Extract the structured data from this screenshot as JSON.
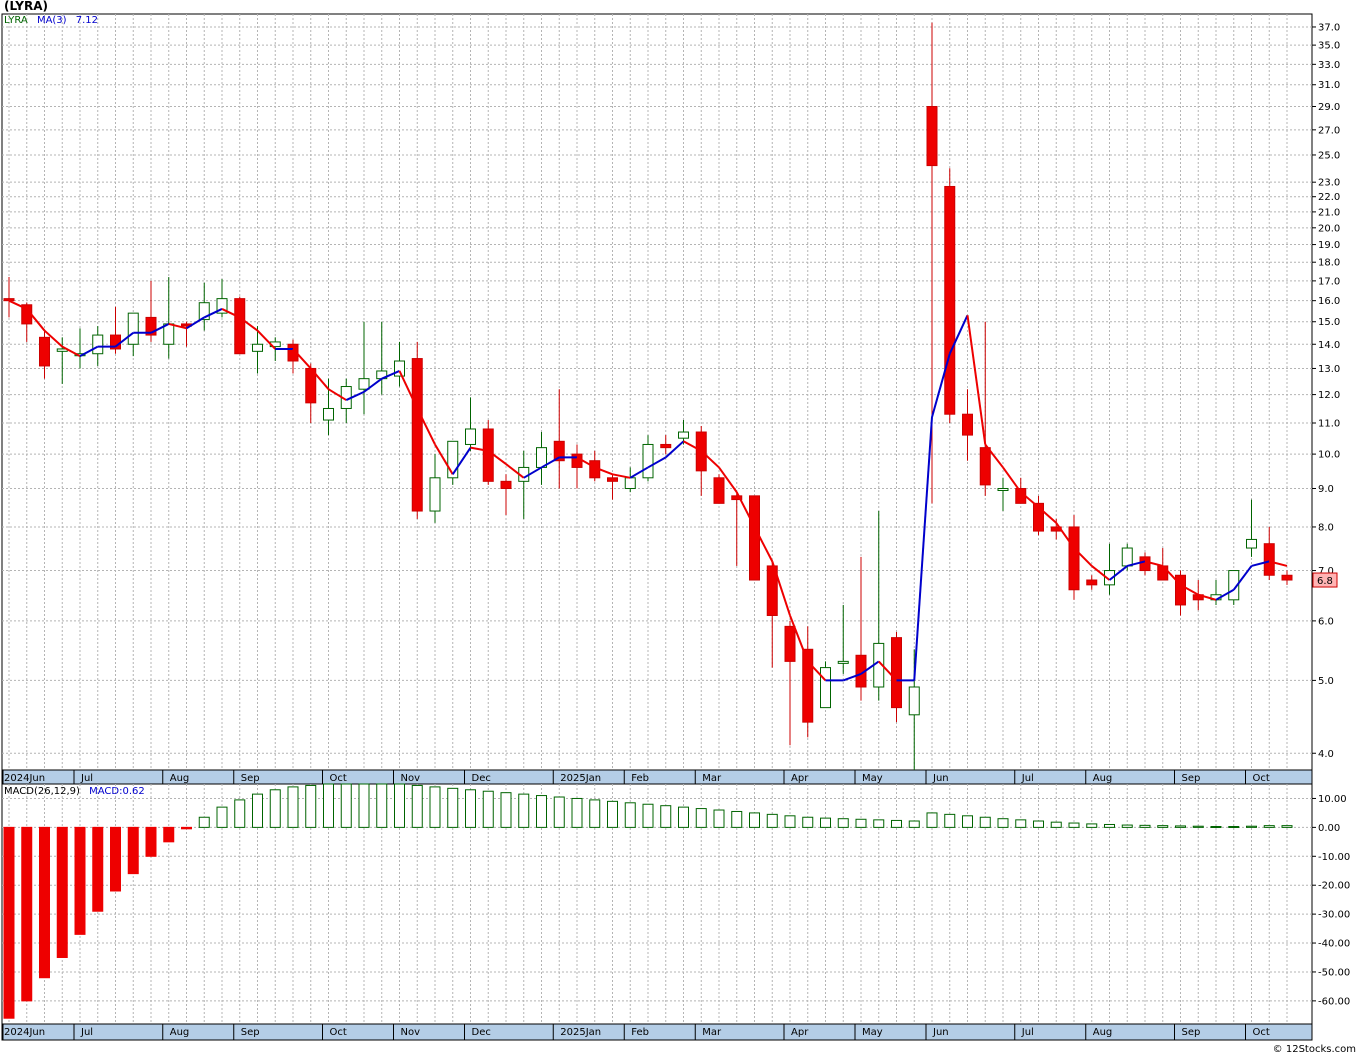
{
  "ticker_label": "(LYRA)",
  "legend": {
    "symbol": "LYRA",
    "ma_label": "MA(3)",
    "ma_value": "7.12",
    "symbol_color": "#006400",
    "ma_color": "#0000cc"
  },
  "macd_legend": {
    "name": "MACD(26,12,9)",
    "value_label": "MACD:0.62"
  },
  "price_tag": "6.8",
  "credit": "© 12Stocks.com",
  "colors": {
    "up_body": "#ffffff",
    "up_border": "#006400",
    "down_body": "#ee0000",
    "down_border": "#cc0000",
    "ma_up": "#0000cc",
    "ma_down": "#ee0000",
    "macd_pos": "#006400",
    "macd_neg": "#ee0000",
    "grid": "#b4b4b4",
    "axis_band": "#b4cde6",
    "price_tag_bg": "#ffb4b4"
  },
  "chart_data": [
    {
      "type": "candlestick",
      "scale": "log",
      "ylim": [
        3.8,
        38.5
      ],
      "grid": true,
      "x_labels": [
        "2024Jun",
        "Jul",
        "Aug",
        "Sep",
        "Oct",
        "Nov",
        "Dec",
        "2025Jan",
        "Feb",
        "Mar",
        "Apr",
        "May",
        "Jun",
        "Jul",
        "Aug",
        "Sep",
        "Oct"
      ],
      "y_ticks": [
        "4.0",
        "5.0",
        "6.0",
        "7.0",
        "8.0",
        "9.0",
        "10.0",
        "11.0",
        "12.0",
        "13.0",
        "14.0",
        "15.0",
        "16.0",
        "17.0",
        "18.0",
        "19.0",
        "20.0",
        "21.0",
        "22.0",
        "23.0",
        "25.0",
        "27.0",
        "29.0",
        "31.0",
        "33.0",
        "35.0",
        "37.0"
      ],
      "bars": [
        {
          "o": 16.1,
          "h": 17.2,
          "l": 15.2,
          "c": 16.0
        },
        {
          "o": 15.8,
          "h": 15.9,
          "l": 14.1,
          "c": 14.9
        },
        {
          "o": 14.3,
          "h": 14.6,
          "l": 12.6,
          "c": 13.1
        },
        {
          "o": 13.7,
          "h": 14.3,
          "l": 12.4,
          "c": 13.8
        },
        {
          "o": 13.6,
          "h": 14.7,
          "l": 13.0,
          "c": 13.6
        },
        {
          "o": 13.6,
          "h": 14.8,
          "l": 13.1,
          "c": 14.4
        },
        {
          "o": 14.4,
          "h": 15.7,
          "l": 13.6,
          "c": 13.8
        },
        {
          "o": 14.0,
          "h": 15.2,
          "l": 13.5,
          "c": 15.4
        },
        {
          "o": 15.2,
          "h": 17.0,
          "l": 14.1,
          "c": 14.4
        },
        {
          "o": 14.0,
          "h": 17.2,
          "l": 13.4,
          "c": 14.9
        },
        {
          "o": 14.9,
          "h": 15.0,
          "l": 13.9,
          "c": 14.8
        },
        {
          "o": 15.1,
          "h": 16.9,
          "l": 14.6,
          "c": 15.9
        },
        {
          "o": 15.4,
          "h": 17.1,
          "l": 15.2,
          "c": 16.1
        },
        {
          "o": 16.1,
          "h": 16.2,
          "l": 13.6,
          "c": 13.6
        },
        {
          "o": 13.7,
          "h": 14.8,
          "l": 12.8,
          "c": 14.0
        },
        {
          "o": 13.9,
          "h": 14.3,
          "l": 13.3,
          "c": 14.1
        },
        {
          "o": 14.0,
          "h": 14.2,
          "l": 12.8,
          "c": 13.3
        },
        {
          "o": 13.0,
          "h": 13.2,
          "l": 11.0,
          "c": 11.7
        },
        {
          "o": 11.1,
          "h": 12.6,
          "l": 10.6,
          "c": 11.5
        },
        {
          "o": 11.5,
          "h": 12.6,
          "l": 11.0,
          "c": 12.3
        },
        {
          "o": 12.2,
          "h": 15.0,
          "l": 11.3,
          "c": 12.6
        },
        {
          "o": 12.6,
          "h": 15.0,
          "l": 12.0,
          "c": 12.9
        },
        {
          "o": 12.7,
          "h": 14.1,
          "l": 12.3,
          "c": 13.3
        },
        {
          "o": 13.4,
          "h": 14.1,
          "l": 8.2,
          "c": 8.4
        },
        {
          "o": 8.4,
          "h": 10.0,
          "l": 8.1,
          "c": 9.3
        },
        {
          "o": 9.3,
          "h": 10.4,
          "l": 9.1,
          "c": 10.4
        },
        {
          "o": 10.3,
          "h": 11.9,
          "l": 10.1,
          "c": 10.8
        },
        {
          "o": 10.8,
          "h": 11.1,
          "l": 9.1,
          "c": 9.2
        },
        {
          "o": 9.2,
          "h": 9.4,
          "l": 8.3,
          "c": 9.0
        },
        {
          "o": 9.2,
          "h": 10.1,
          "l": 8.2,
          "c": 9.6
        },
        {
          "o": 9.6,
          "h": 10.7,
          "l": 9.1,
          "c": 10.2
        },
        {
          "o": 10.4,
          "h": 12.2,
          "l": 9.0,
          "c": 9.8
        },
        {
          "o": 10.0,
          "h": 10.3,
          "l": 9.0,
          "c": 9.6
        },
        {
          "o": 9.8,
          "h": 10.1,
          "l": 9.2,
          "c": 9.3
        },
        {
          "o": 9.3,
          "h": 9.4,
          "l": 8.7,
          "c": 9.2
        },
        {
          "o": 9.0,
          "h": 9.6,
          "l": 8.9,
          "c": 9.3
        },
        {
          "o": 9.3,
          "h": 10.6,
          "l": 9.2,
          "c": 10.3
        },
        {
          "o": 10.3,
          "h": 10.6,
          "l": 10.0,
          "c": 10.2
        },
        {
          "o": 10.5,
          "h": 11.1,
          "l": 10.3,
          "c": 10.7
        },
        {
          "o": 10.7,
          "h": 10.9,
          "l": 8.8,
          "c": 9.5
        },
        {
          "o": 9.3,
          "h": 9.4,
          "l": 8.6,
          "c": 8.6
        },
        {
          "o": 8.8,
          "h": 8.9,
          "l": 7.1,
          "c": 8.7
        },
        {
          "o": 8.8,
          "h": 8.8,
          "l": 6.8,
          "c": 6.8
        },
        {
          "o": 7.1,
          "h": 7.2,
          "l": 5.2,
          "c": 6.1
        },
        {
          "o": 5.9,
          "h": 6.0,
          "l": 4.1,
          "c": 5.3
        },
        {
          "o": 5.5,
          "h": 5.9,
          "l": 4.2,
          "c": 4.4
        },
        {
          "o": 4.6,
          "h": 5.3,
          "l": 4.6,
          "c": 5.2
        },
        {
          "o": 5.3,
          "h": 6.3,
          "l": 5.1,
          "c": 5.3
        },
        {
          "o": 5.4,
          "h": 7.3,
          "l": 4.7,
          "c": 4.9
        },
        {
          "o": 4.9,
          "h": 8.4,
          "l": 4.7,
          "c": 5.6
        },
        {
          "o": 5.7,
          "h": 5.8,
          "l": 4.4,
          "c": 4.6
        },
        {
          "o": 4.5,
          "h": 5.5,
          "l": 3.8,
          "c": 4.9
        },
        {
          "o": 29.0,
          "h": 37.5,
          "l": 8.6,
          "c": 24.2
        },
        {
          "o": 22.7,
          "h": 24.0,
          "l": 11.0,
          "c": 11.3
        },
        {
          "o": 11.3,
          "h": 12.2,
          "l": 9.8,
          "c": 10.6
        },
        {
          "o": 10.2,
          "h": 15.0,
          "l": 8.8,
          "c": 9.1
        },
        {
          "o": 9.0,
          "h": 9.3,
          "l": 8.4,
          "c": 9.0
        },
        {
          "o": 9.0,
          "h": 9.3,
          "l": 8.6,
          "c": 8.6
        },
        {
          "o": 8.6,
          "h": 8.8,
          "l": 7.8,
          "c": 7.9
        },
        {
          "o": 8.0,
          "h": 8.2,
          "l": 7.7,
          "c": 7.9
        },
        {
          "o": 8.0,
          "h": 8.3,
          "l": 6.4,
          "c": 6.6
        },
        {
          "o": 6.8,
          "h": 6.9,
          "l": 6.6,
          "c": 6.7
        },
        {
          "o": 6.7,
          "h": 7.6,
          "l": 6.5,
          "c": 7.0
        },
        {
          "o": 7.1,
          "h": 7.6,
          "l": 7.0,
          "c": 7.5
        },
        {
          "o": 7.3,
          "h": 7.4,
          "l": 6.9,
          "c": 7.0
        },
        {
          "o": 7.1,
          "h": 7.5,
          "l": 6.8,
          "c": 6.8
        },
        {
          "o": 6.9,
          "h": 7.0,
          "l": 6.1,
          "c": 6.3
        },
        {
          "o": 6.5,
          "h": 6.8,
          "l": 6.2,
          "c": 6.4
        },
        {
          "o": 6.4,
          "h": 6.8,
          "l": 6.3,
          "c": 6.5
        },
        {
          "o": 6.4,
          "h": 7.0,
          "l": 6.3,
          "c": 7.0
        },
        {
          "o": 7.5,
          "h": 8.7,
          "l": 7.3,
          "c": 7.7
        },
        {
          "o": 7.6,
          "h": 8.0,
          "l": 6.8,
          "c": 6.9
        },
        {
          "o": 6.9,
          "h": 7.0,
          "l": 6.7,
          "c": 6.8
        }
      ],
      "ma3": [
        16.0,
        15.6,
        14.6,
        13.9,
        13.5,
        13.9,
        13.9,
        14.5,
        14.5,
        14.9,
        14.7,
        15.2,
        15.6,
        15.2,
        14.6,
        13.8,
        13.8,
        13.0,
        12.2,
        11.8,
        12.1,
        12.6,
        12.9,
        11.5,
        10.3,
        9.4,
        10.2,
        10.1,
        9.7,
        9.3,
        9.6,
        9.9,
        9.9,
        9.6,
        9.4,
        9.3,
        9.6,
        9.9,
        10.4,
        10.1,
        9.6,
        8.9,
        8.0,
        7.2,
        6.1,
        5.3,
        5.0,
        5.0,
        5.1,
        5.3,
        5.0,
        5.0,
        11.2,
        13.6,
        15.3,
        10.3,
        9.6,
        8.9,
        8.5,
        8.1,
        7.5,
        7.1,
        6.8,
        7.1,
        7.2,
        7.1,
        6.7,
        6.5,
        6.4,
        6.6,
        7.1,
        7.2,
        7.1
      ],
      "ma3_label": "MA(3)"
    },
    {
      "type": "bar",
      "title": "MACD(26,12,9)",
      "ylim": [
        -68,
        15
      ],
      "y_ticks": [
        "10.00",
        "0.00",
        "-10.00",
        "-20.00",
        "-30.00",
        "-40.00",
        "-50.00",
        "-60.00"
      ],
      "x_labels": [
        "2024Jun",
        "Jul",
        "Aug",
        "Sep",
        "Oct",
        "Nov",
        "Dec",
        "2025Jan",
        "Feb",
        "Mar",
        "Apr",
        "May",
        "Jun",
        "Jul",
        "Aug",
        "Sep",
        "Oct"
      ],
      "values": [
        -66.0,
        -60.0,
        -52.0,
        -45.0,
        -37.0,
        -29.0,
        -22.0,
        -16.0,
        -10.0,
        -5.0,
        -0.5,
        3.5,
        7.0,
        9.5,
        11.5,
        13.0,
        14.0,
        14.5,
        15.0,
        15.0,
        15.0,
        15.0,
        15.0,
        14.5,
        14.0,
        13.5,
        13.0,
        12.5,
        12.0,
        11.5,
        11.0,
        10.5,
        10.0,
        9.5,
        9.0,
        8.5,
        8.0,
        7.5,
        7.0,
        6.5,
        6.0,
        5.5,
        5.0,
        4.5,
        4.0,
        3.5,
        3.2,
        3.0,
        2.8,
        2.6,
        2.4,
        2.2,
        5.0,
        4.5,
        4.0,
        3.5,
        3.0,
        2.6,
        2.2,
        1.8,
        1.5,
        1.2,
        1.0,
        0.8,
        0.7,
        0.6,
        0.5,
        0.4,
        0.3,
        0.3,
        0.4,
        0.6,
        0.6
      ]
    }
  ]
}
